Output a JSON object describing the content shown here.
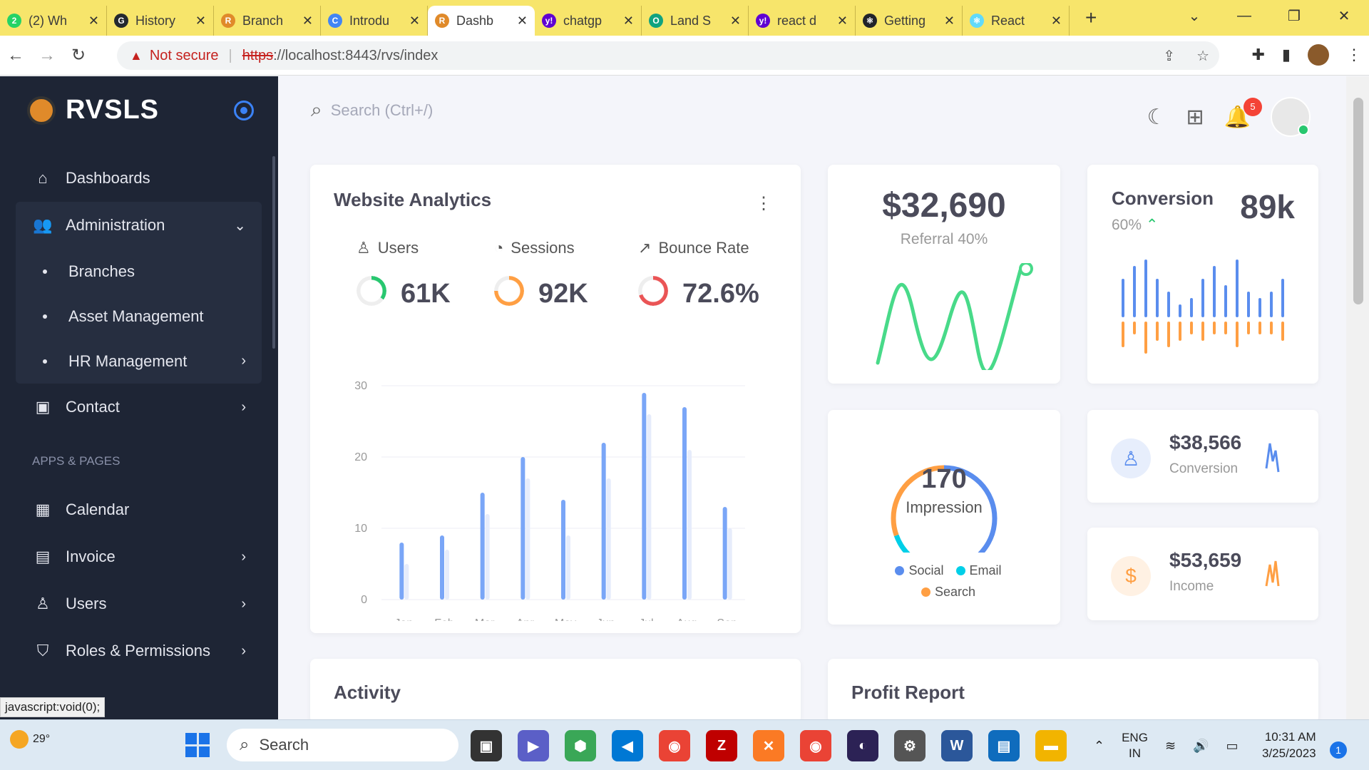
{
  "browser": {
    "tabs": [
      {
        "title": "(2) Wh",
        "color": "#25d366",
        "glyph": "2"
      },
      {
        "title": "History",
        "color": "#24292f",
        "glyph": "G"
      },
      {
        "title": "Branch",
        "color": "#e08a2a",
        "glyph": "R"
      },
      {
        "title": "Introdu",
        "color": "#4285f4",
        "glyph": "C"
      },
      {
        "title": "Dashb",
        "color": "#e08a2a",
        "glyph": "R",
        "active": true
      },
      {
        "title": "chatgp",
        "color": "#6001d2",
        "glyph": "y!"
      },
      {
        "title": "Land S",
        "color": "#10a37f",
        "glyph": "O"
      },
      {
        "title": "react d",
        "color": "#6001d2",
        "glyph": "y!"
      },
      {
        "title": "Getting",
        "color": "#20232a",
        "glyph": "⚛"
      },
      {
        "title": "React",
        "color": "#61dafb",
        "glyph": "⚛"
      }
    ],
    "not_secure": "Not secure",
    "url_scheme": "https",
    "url_rest": "://localhost:8443/rvs/index",
    "status_text": "javascript:void(0);"
  },
  "sidebar": {
    "brand": "RVSLS",
    "items": [
      {
        "label": "Dashboards",
        "icon": "home-icon"
      },
      {
        "label": "Administration",
        "icon": "users-icon"
      },
      {
        "label": "Branches"
      },
      {
        "label": "Asset Management"
      },
      {
        "label": "HR Management"
      },
      {
        "label": "Contact",
        "icon": "contact-icon"
      }
    ],
    "section": "APPS & PAGES",
    "apps": [
      {
        "label": "Calendar",
        "icon": "calendar-icon"
      },
      {
        "label": "Invoice",
        "icon": "invoice-icon"
      },
      {
        "label": "Users",
        "icon": "user-icon"
      },
      {
        "label": "Roles & Permissions",
        "icon": "shield-icon"
      }
    ]
  },
  "header": {
    "search_placeholder": "Search (Ctrl+/)",
    "notifications": "5"
  },
  "analytics": {
    "title": "Website Analytics",
    "metrics": [
      {
        "label": "Users",
        "value": "61K",
        "color": "#28c76f",
        "pct": 0.35
      },
      {
        "label": "Sessions",
        "value": "92K",
        "color": "#ff9f43",
        "pct": 0.75
      },
      {
        "label": "Bounce Rate",
        "value": "72.6%",
        "color": "#ea5455",
        "pct": 0.7
      }
    ]
  },
  "chart_data": {
    "type": "bar",
    "categories": [
      "Jan",
      "Feb",
      "Mar",
      "Apr",
      "May",
      "Jun",
      "Jul",
      "Aug",
      "Sep"
    ],
    "series": [
      {
        "values": [
          8,
          9,
          15,
          20,
          14,
          22,
          29,
          27,
          13
        ],
        "color": "#7aa6f7"
      },
      {
        "values": [
          5,
          7,
          12,
          17,
          9,
          17,
          26,
          21,
          10
        ],
        "color": "#e6ecfb"
      }
    ],
    "ylim": [
      0,
      30
    ],
    "yticks": [
      0,
      10,
      20,
      30
    ],
    "grid": true
  },
  "revenue": {
    "value": "$32,690",
    "sub": "Referral 40%",
    "color": "#48da89"
  },
  "conversion": {
    "title": "Conversion",
    "value": "89k",
    "pct": "60%",
    "trend": "^",
    "up": [
      6,
      8,
      9,
      6,
      4,
      2,
      3,
      6,
      8,
      5,
      9,
      4,
      3,
      4,
      6
    ],
    "down": [
      4,
      2,
      5,
      3,
      4,
      3,
      2,
      3,
      2,
      2,
      4,
      2,
      2,
      2,
      3
    ]
  },
  "impression": {
    "value": "170",
    "label": "Impression",
    "legend": [
      {
        "label": "Social",
        "color": "#5a8dee"
      },
      {
        "label": "Email",
        "color": "#00cfe8"
      },
      {
        "label": "Search",
        "color": "#ff9f43"
      }
    ]
  },
  "mini_cards": [
    {
      "value": "$38,566",
      "label": "Conversion",
      "color": "#5a8dee",
      "bg": "#e7eefc"
    },
    {
      "value": "$53,659",
      "label": "Income",
      "color": "#ff9f43",
      "bg": "#fff1e3"
    }
  ],
  "activity": {
    "title": "Activity"
  },
  "profit": {
    "title": "Profit Report"
  },
  "taskbar": {
    "temp": "29°",
    "search": "Search",
    "lang": "ENG",
    "region": "IN",
    "time": "10:31 AM",
    "date": "3/25/2023",
    "notif": "1"
  }
}
